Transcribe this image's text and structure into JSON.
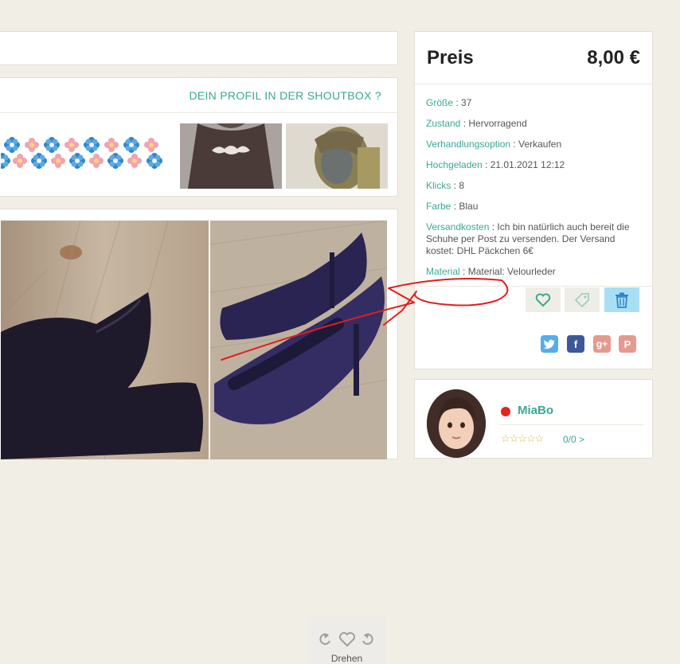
{
  "shoutbox": {
    "link_label": "DEIN PROFIL IN DER SHOUTBOX ?"
  },
  "price": {
    "label": "Preis",
    "value": "8,00 €"
  },
  "details": [
    {
      "key": "Größe",
      "value": "37"
    },
    {
      "key": "Zustand",
      "value": "Hervorragend"
    },
    {
      "key": "Verhandlungsoption",
      "value": "Verkaufen"
    },
    {
      "key": "Hochgeladen",
      "value": "21.01.2021 12:12"
    },
    {
      "key": "Klicks",
      "value": "8"
    },
    {
      "key": "Farbe",
      "value": "Blau"
    },
    {
      "key": "Versandkosten",
      "value": "Ich bin natürlich auch bereit die Schuhe per Post zu versenden. Der Versand kostet: DHL Päckchen 6€"
    },
    {
      "key": "Material",
      "value": "Material: Velourleder"
    }
  ],
  "actions": {
    "favorite_icon": "heart-icon",
    "tag_icon": "price-tag-icon",
    "delete_icon": "trash-icon"
  },
  "share": {
    "twitter": {
      "icon": "twitter-icon",
      "color": "#55acee"
    },
    "facebook": {
      "icon": "facebook-icon",
      "color": "#3b5998",
      "glyph": "f"
    },
    "googleplus": {
      "icon": "google-plus-icon",
      "color": "#e59a8f",
      "glyph": "g+"
    },
    "pinterest": {
      "icon": "pinterest-icon",
      "color": "#e59a8f",
      "glyph": "P"
    }
  },
  "photo_controls": {
    "rotate_label": "Drehen"
  },
  "seller": {
    "name": "MiaBo",
    "status": "offline",
    "status_color": "#e0251b",
    "rating_text": "0/0 >",
    "stars": 5
  },
  "colors": {
    "accent": "#3aa894",
    "delete_bg": "#a9dff5",
    "action_bg": "#efeee6"
  }
}
